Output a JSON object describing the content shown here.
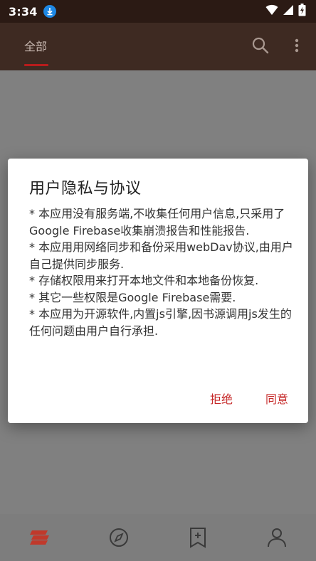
{
  "status_bar": {
    "time": "3:34",
    "download_icon": "download-icon",
    "wifi_icon": "wifi-icon",
    "signal_icon": "signal-icon",
    "battery_icon": "battery-charging-icon"
  },
  "app_bar": {
    "tab_all": "全部",
    "search_icon": "search-icon",
    "more_icon": "more-vert-icon"
  },
  "dialog": {
    "title": "用户隐私与协议",
    "paragraphs": [
      "* 本应用没有服务端,不收集任何用户信息,只采用了Google Firebase收集崩溃报告和性能报告.",
      "* 本应用用网络同步和备份采用webDav协议,由用户自己提供同步服务.",
      "* 存储权限用来打开本地文件和本地备份恢复.",
      "* 其它一些权限是Google Firebase需要.",
      "* 本应用为开源软件,内置js引擎,因书源调用js发生的任何问题由用户自行承担."
    ],
    "decline_label": "拒绝",
    "agree_label": "同意"
  },
  "bottom_nav": {
    "items": [
      "bookshelf-icon",
      "explore-icon",
      "add-bookmark-icon",
      "profile-icon"
    ]
  },
  "colors": {
    "status_bar": "#2b1a14",
    "app_bar": "#3e2a22",
    "accent": "#c62828",
    "scrim": "#808080"
  }
}
